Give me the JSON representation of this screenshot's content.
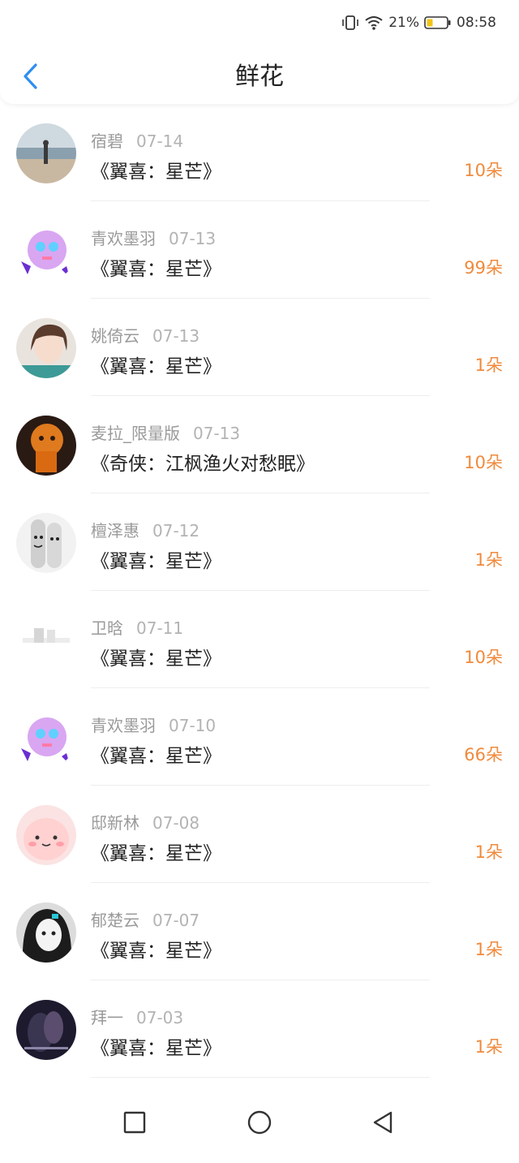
{
  "status_bar": {
    "battery_percent": "21%",
    "time": "08:58"
  },
  "header": {
    "title": "鲜花",
    "back_icon": "chevron-left-icon"
  },
  "colors": {
    "accent": "#2f8ef0",
    "amount": "#f08a3c"
  },
  "gifts": [
    {
      "name": "宿碧",
      "date": "07-14",
      "book": "《翼喜：星芒》",
      "amount": "10朵"
    },
    {
      "name": "青欢墨羽",
      "date": "07-13",
      "book": "《翼喜：星芒》",
      "amount": "99朵"
    },
    {
      "name": "姚倚云",
      "date": "07-13",
      "book": "《翼喜：星芒》",
      "amount": "1朵"
    },
    {
      "name": "麦拉_限量版",
      "date": "07-13",
      "book": "《奇侠：江枫渔火对愁眠》",
      "amount": "10朵"
    },
    {
      "name": "檀泽惠",
      "date": "07-12",
      "book": "《翼喜：星芒》",
      "amount": "1朵"
    },
    {
      "name": "卫晗",
      "date": "07-11",
      "book": "《翼喜：星芒》",
      "amount": "10朵"
    },
    {
      "name": "青欢墨羽",
      "date": "07-10",
      "book": "《翼喜：星芒》",
      "amount": "66朵"
    },
    {
      "name": "邸新林",
      "date": "07-08",
      "book": "《翼喜：星芒》",
      "amount": "1朵"
    },
    {
      "name": "郁楚云",
      "date": "07-07",
      "book": "《翼喜：星芒》",
      "amount": "1朵"
    },
    {
      "name": "拜一",
      "date": "07-03",
      "book": "《翼喜：星芒》",
      "amount": "1朵"
    }
  ],
  "nav": {
    "recent": "square-icon",
    "home": "circle-icon",
    "back": "triangle-back-icon"
  }
}
